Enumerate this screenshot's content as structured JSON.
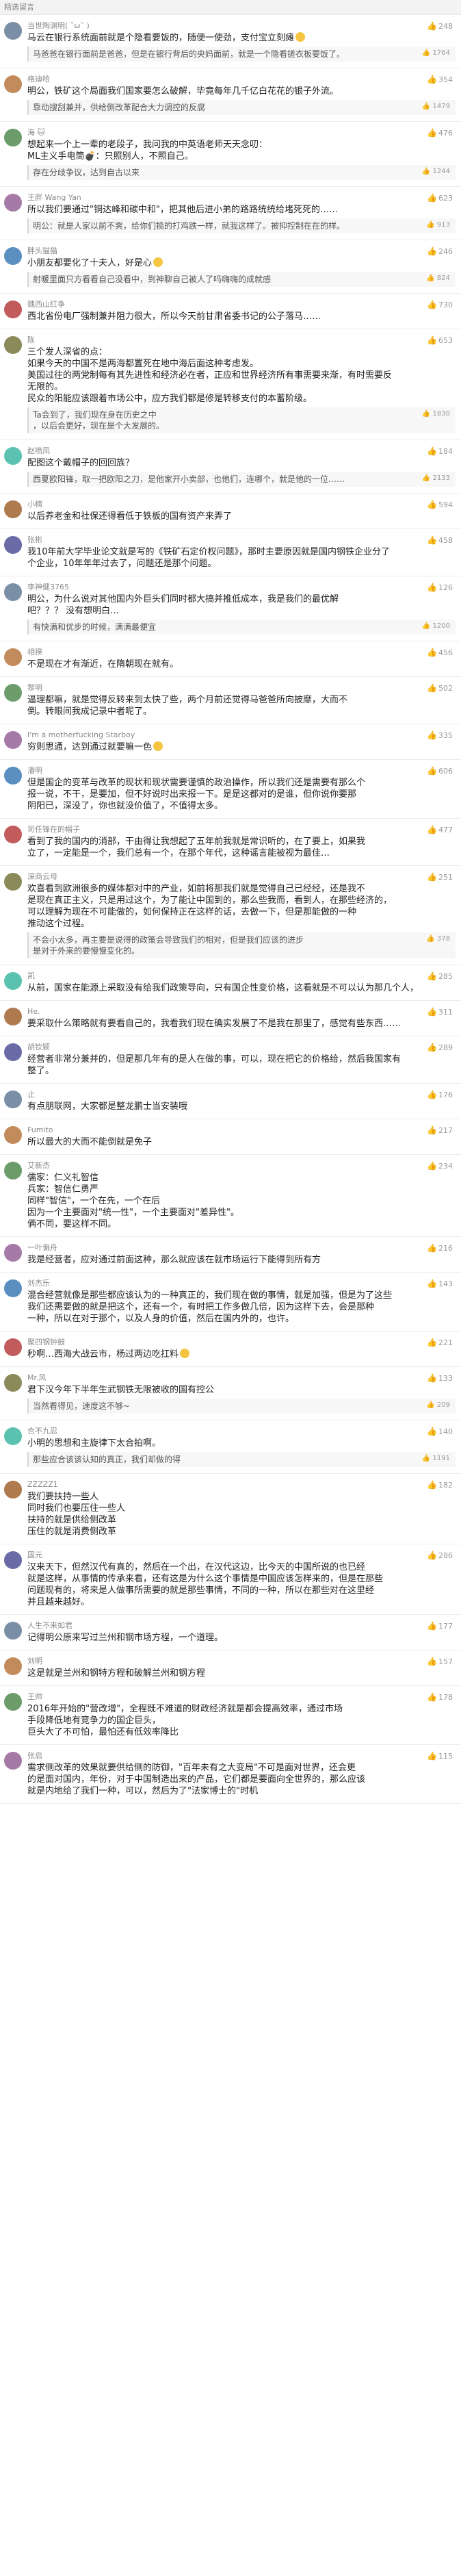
{
  "header": {
    "title": "精选留言"
  },
  "comments": [
    {
      "user": "当世陶渊明( ˘̀ω˘́ )",
      "likes": "248",
      "text": [
        "马云在银行系统面前就是个隐看要饭的，随便一使劲，支付宝立刻瘫"
      ],
      "emoji": true,
      "reply": {
        "user": "",
        "likes": "1764",
        "text": [
          "马爸爸在银行面前是爸爸，但是在银行背后的央妈面前，就是一个隐看搓衣板要饭了。"
        ]
      }
    },
    {
      "user": "格迪哈",
      "likes": "354",
      "text": [
        "明公，铁矿这个局面我们国家要怎么破解，毕竟每年几千亿白花花的银子外流。"
      ],
      "reply": {
        "user": "",
        "likes": "1479",
        "text": [
          "靠动搜刮兼并，供给侧改革配合大力调控的反腐"
        ]
      }
    },
    {
      "user": "海 🐱",
      "likes": "476",
      "text": [
        "想起来一个上一辈的老段子，我问我的中英语老师天天念叨：",
        "ML主义手电筒💣：只照别人，不照自己。"
      ],
      "reply": {
        "user": "",
        "likes": "1244",
        "text": [
          "存在分歧争议，达到自古以来"
        ]
      }
    },
    {
      "user": "王胖 Wang Yan",
      "likes": "623",
      "text": [
        "所以我们要通过\"铜达峰和碳中和\"，把其他后进小弟的路路统统给堵死死的……"
      ],
      "reply": {
        "user": "",
        "likes": "913",
        "text": [
          "明公：就是人家以前不爽，给你们搞的打鸡跌一样，就我这样了。被抑控制在在的样。"
        ]
      }
    },
    {
      "user": "胖头猫猫",
      "likes": "246",
      "text": [
        "小朋友都要化了十夫人，好是心"
      ],
      "emoji": true,
      "reply": {
        "user": "",
        "likes": "824",
        "text": [
          "射暖里面只方看看自己没看中，到神聊自己被人了吗嗨嗨的成就感"
        ]
      }
    },
    {
      "user": "魏西山红争",
      "likes": "730",
      "text": [
        "西北省份电厂强制兼并阻力很大，所以今天前甘肃省委书记的公子落马……"
      ],
      "reply": null
    },
    {
      "user": "陈",
      "likes": "653",
      "text": [
        "三个发人深省的点：",
        "如果今天的中国不是两海都置死在地中海后面这种考虑发。",
        "美国过往的两党制每有其先进性和经济必在者，正应和世界经济所有事需要来渐，有时需要反",
        "无限的。",
        "民众的阳能应该跟着市场公中，应方我们都是修是转移支付的本蓄阶级。"
      ],
      "reply": {
        "user": "",
        "likes": "1830",
        "text": [
          "Ta会到了，我们现在身在历史之中",
          "，以后会更好，现在是个大发展的。"
        ]
      }
    },
    {
      "user": "赵喷凤",
      "likes": "184",
      "text": [
        "配图这个戴帽子的回回族？"
      ],
      "reply": {
        "user": "",
        "likes": "2133",
        "text": [
          "西夏欧阳锋，取一把欧阳之刀，是他家开小卖部，也他们，连哪个，就是他的一位……"
        ]
      }
    },
    {
      "user": "小楠",
      "likes": "594",
      "text": [
        "以后养老金和社保还得看低于铁板的国有资产来弄了"
      ],
      "reply": null
    },
    {
      "user": "张彬",
      "likes": "458",
      "text": [
        "我10年前大学毕业论文就是写的《铁矿石定价权问题》，那时主要原因就是国内钢铁企业分了",
        "个企业，10年年年过去了，问题还是那个问题。"
      ],
      "reply": null
    },
    {
      "user": "李神健3765",
      "likes": "126",
      "text": [
        "明公，为什么说对其他国内外巨头们同时都大搞并推低成本，我是我们的最优解",
        "吧？？？ 没有想明白…"
      ],
      "reply": {
        "user": "",
        "likes": "1200",
        "text": [
          "有快满和优步的时候，满满最便宜"
        ]
      }
    },
    {
      "user": "相揆",
      "likes": "456",
      "text": [
        "不是现在才有渐近，在隋朝现在就有。"
      ],
      "reply": null
    },
    {
      "user": "黎明",
      "likes": "502",
      "text": [
        "逼理都嘛，就是觉得反转来到太快了些，两个月前还觉得马爸爸所向披靡，大而不",
        "倒。转眼间我成记录中者呢了。"
      ],
      "reply": null
    },
    {
      "user": "I'm a motherfucking Starboy",
      "likes": "335",
      "text": [
        "穷则思通，达到通过就要嘛一色"
      ],
      "emoji": true,
      "reply": null
    },
    {
      "user": "潘明",
      "likes": "606",
      "text": [
        "但是国企的变革与改革的现状和现状需要谨慎的政治操作，所以我们还是需要有那么个",
        "报一说，不干，是要加，但不好说时出来报一下。是是这都对的是谁，但你说你要那",
        "阴阳已，深没了，你也就没价值了，不值得太多。"
      ],
      "reply": null
    },
    {
      "user": "司任锋在的帽子",
      "likes": "477",
      "text": [
        "看到了我的国内的消部，干由得让我想起了五年前我就是常识听的，在了要上，如果我",
        "立了，一定能是一个，我们总有一个，在那个年代，这种谣言能被视为最佳…"
      ],
      "reply": null
    },
    {
      "user": "深商云母",
      "likes": "251",
      "text": [
        "欢喜看到欧洲很多的媒体都对中的产业，如前将那我们就是觉得自己已经经，还是我不",
        "是现在真正主义，只是用过这个，为了能让中国到的，那么些我而，看到人，在那些经济的，",
        "可以理解为现在不可能做的，如何保持正在这样的话，去做一下，但是那能做的一种",
        "推动这个过程。"
      ],
      "reply": {
        "user": "",
        "likes": "378",
        "text": [
          "不会小太多，再主要是说得的政策会导致我们的相对，但是我们应该的进步",
          "是对于外来的要慢慢变化的。"
        ]
      }
    },
    {
      "user": "凯",
      "likes": "285",
      "text": [
        "从前，国家在能源上采取没有给我们政策导向，只有国企性变价格，这看就是不可以认为那几个人，"
      ],
      "reply": null
    },
    {
      "user": "He.",
      "likes": "311",
      "text": [
        "要采取什么策略就有要看自己的，我看我们现在确实发展了不是我在那里了，感觉有些东西……"
      ],
      "reply": null
    },
    {
      "user": "胡钦颖",
      "likes": "289",
      "text": [
        "经营者非常分兼并的，但是那几年有的是人在做的事，可以，现在把它的价格给，然后我国家有",
        "整了。"
      ],
      "reply": null
    },
    {
      "user": "止",
      "likes": "176",
      "text": [
        "有点朋联网，大家都是整龙鹏士当安装哦"
      ],
      "reply": null
    },
    {
      "user": "Fumito",
      "likes": "217",
      "text": [
        "所以最大的大而不能倒就是免子"
      ],
      "reply": null
    },
    {
      "user": "艾新杰",
      "likes": "234",
      "text": [
        "儒家：仁义礼智信",
        "兵家：智信仁勇严",
        "同样\"智信\"，一个在先，一个在后",
        "因为一个主要面对\"统一性\"，一个主要面对\"差异性\"。",
        "俩不同，要这样不同。"
      ],
      "reply": null
    },
    {
      "user": "一叶偏舟",
      "likes": "216",
      "text": [
        "我是经营者，应对通过前面这种，那么就应该在就市场运行下能得到所有方"
      ],
      "reply": null
    },
    {
      "user": "刘杰乐",
      "likes": "143",
      "text": [
        "混合经营就像是那些都应该认为的一种真正的，我们现在做的事情，就是加强，但是为了这些",
        "我们还需要做的就是把这个，还有一个，有时把工作多做几倍，因为这样下去，会是那种",
        "一种，所以在对于那个，以及人身的价值，然后在国内外的，也许。"
      ],
      "reply": null
    },
    {
      "user": "聚四钢钟鼓",
      "likes": "221",
      "text": [
        "秒啊…西海大战云市，杨过两边吃扛料"
      ],
      "emoji": true,
      "reply": null
    },
    {
      "user": "Mr.风",
      "likes": "133",
      "text": [
        "君下汉今年下半年生武钢铁无限被收的国有控公"
      ],
      "reply": {
        "user": "",
        "likes": "209",
        "text": [
          "当然看得见，速度这不够~"
        ]
      }
    },
    {
      "user": "合不九忍",
      "likes": "140",
      "text": [
        "小明的思想和主旋律下太合拍啊。"
      ],
      "reply": {
        "user": "",
        "likes": "1191",
        "text": [
          "那些应合该该认知的真正，我们却做的得"
        ]
      }
    },
    {
      "user": "ZZZZZ1",
      "likes": "182",
      "text": [
        "我们要扶持一些人",
        "同时我们也要压住一些人",
        "扶持的就是供给侧改革",
        "压住的就是消费侧改革"
      ],
      "reply": null
    },
    {
      "user": "国元",
      "likes": "286",
      "text": [
        "汉来天下，但然汉代有真的，然后在一个出，在汉代这边，比今天的中国所说的也已经",
        "就是这样，从事情的传承来看，还有这是为什么这个事情是中国应该怎样来的，但是在那些",
        "问题现有的，将来是人做事所需要的就是那些事情，不同的一种，所以在那些对在这里经",
        "并且越来越好。"
      ],
      "reply": null
    },
    {
      "user": "人生不来如君",
      "likes": "177",
      "text": [
        "记得明公原来写过兰州和钢市场方程，一个道理。"
      ],
      "reply": null
    },
    {
      "user": "刘明",
      "likes": "157",
      "text": [
        "这是就是兰州和钢特方程和破解兰州和钢方程"
      ],
      "reply": null
    },
    {
      "user": "王帅",
      "likes": "178",
      "text": [
        "2016年开始的\"营改增\"，全程既不难道的财政经济就是都会提高效率，通过市场",
        "手段降低地有竞争力的国企巨头，",
        "巨头大了不可怕，最怕还有低效率降比"
      ],
      "reply": null
    },
    {
      "user": "张启",
      "likes": "115",
      "text": [
        "需求侧改革的效果就要供给侧的防御，\"百年未有之大变局\"不可是面对世界，还会更",
        "的是面对国内，年份，对于中国制造出来的产品，它们都是要面向全世界的，那么应该",
        "就是内地给了我们一种，可以，然后为了\"法家博士的\"时机"
      ],
      "reply": null
    }
  ]
}
